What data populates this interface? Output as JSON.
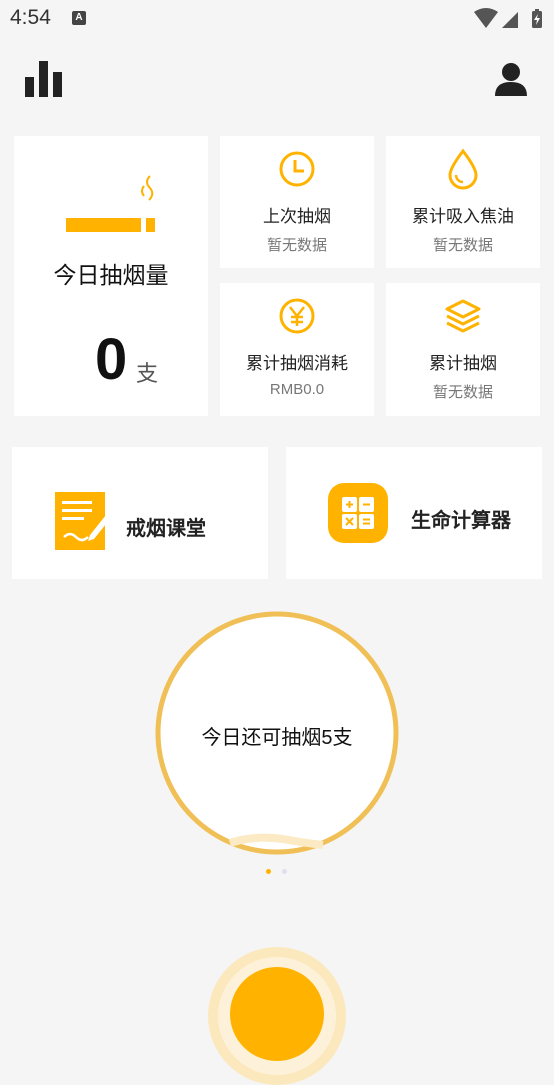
{
  "status_bar": {
    "time": "4:54",
    "notif_letter": "A"
  },
  "header": {
    "stats_icon": "bar-chart-icon",
    "profile_icon": "user-icon"
  },
  "today": {
    "title": "今日抽烟量",
    "count": "0",
    "unit": "支"
  },
  "stats": [
    {
      "icon": "clock-icon",
      "title": "上次抽烟",
      "value": "暂无数据"
    },
    {
      "icon": "drop-icon",
      "title": "累计吸入焦油",
      "value": "暂无数据"
    },
    {
      "icon": "yen-icon",
      "title": "累计抽烟消耗",
      "value": "RMB0.0"
    },
    {
      "icon": "layers-icon",
      "title": "累计抽烟",
      "value": "暂无数据"
    }
  ],
  "tiles": [
    {
      "icon": "notepad-icon",
      "label": "戒烟课堂"
    },
    {
      "icon": "calculator-icon",
      "label": "生命计算器"
    }
  ],
  "remaining": {
    "text": "今日还可抽烟5支"
  },
  "colors": {
    "accent": "#ffb300",
    "ring": "#f0bf55",
    "background": "#f5f5f5"
  }
}
